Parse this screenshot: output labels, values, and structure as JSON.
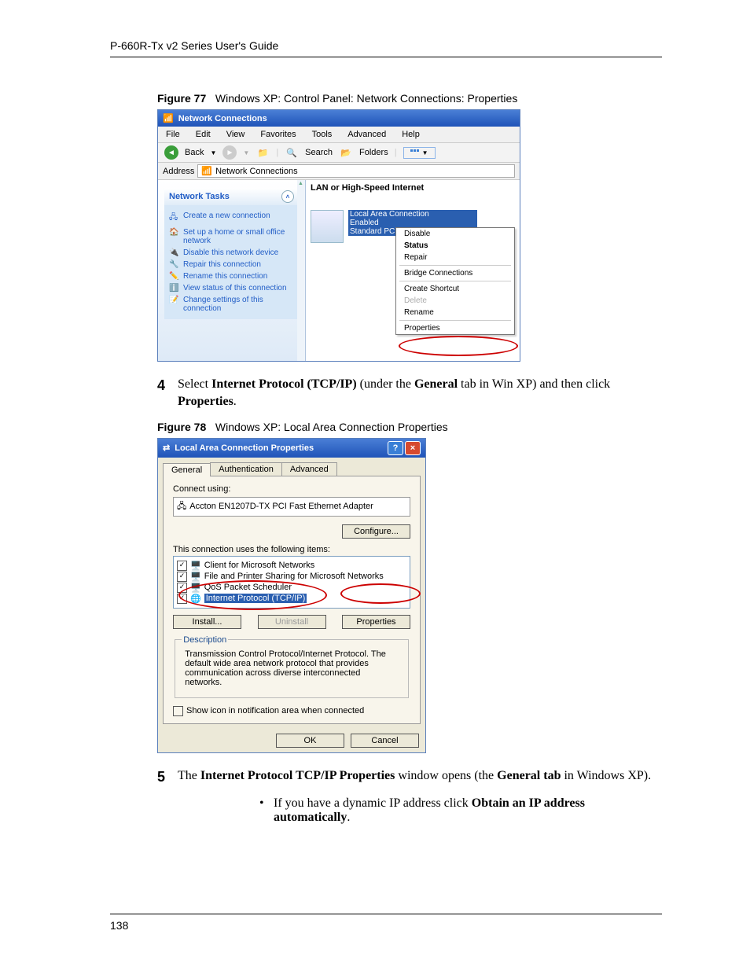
{
  "header_title": "P-660R-Tx v2 Series User's Guide",
  "page_number": "138",
  "figure77": {
    "label": "Figure 77",
    "title": "Windows XP: Control Panel: Network Connections: Properties"
  },
  "figure78": {
    "label": "Figure 78",
    "title": "Windows XP: Local Area Connection Properties"
  },
  "step4": {
    "num": "4",
    "text_before": "Select ",
    "b1": "Internet Protocol (TCP/IP)",
    "text_mid": " (under the ",
    "b2": "General",
    "text_mid2": " tab in Win XP) and then click ",
    "b3": "Properties",
    "text_after": "."
  },
  "step5": {
    "num": "5",
    "t1": "The ",
    "b1": "Internet Protocol TCP/IP Properties",
    "t2": " window opens (the ",
    "b2": "General tab",
    "t3": " in Windows XP)."
  },
  "bullet1": {
    "t1": "If you have a dynamic IP address click ",
    "b1": "Obtain an IP address automatically",
    "t2": "."
  },
  "win1": {
    "title": "Network Connections",
    "menu": {
      "file": "File",
      "edit": "Edit",
      "view": "View",
      "favorites": "Favorites",
      "tools": "Tools",
      "advanced": "Advanced",
      "help": "Help"
    },
    "toolbar": {
      "back": "Back",
      "search": "Search",
      "folders": "Folders"
    },
    "address_label": "Address",
    "address_value": "Network Connections",
    "tasks_header": "Network Tasks",
    "tasks": [
      "Create a new connection",
      "Set up a home or small office network",
      "Disable this network device",
      "Repair this connection",
      "Rename this connection",
      "View status of this connection",
      "Change settings of this connection"
    ],
    "section_head": "LAN or High-Speed Internet",
    "conn": {
      "name": "Local Area Connection",
      "status": "Enabled",
      "adapter": "Standard PCI Fast Ethernet Adapter"
    },
    "ctx": {
      "disable": "Disable",
      "status": "Status",
      "repair": "Repair",
      "bridge": "Bridge Connections",
      "shortcut": "Create Shortcut",
      "delete": "Delete",
      "rename": "Rename",
      "properties": "Properties"
    }
  },
  "win2": {
    "title": "Local Area Connection Properties",
    "tabs": {
      "general": "General",
      "auth": "Authentication",
      "advanced": "Advanced"
    },
    "connect_using": "Connect using:",
    "adapter": "Accton EN1207D-TX PCI Fast Ethernet Adapter",
    "configure": "Configure...",
    "uses_label": "This connection uses the following items:",
    "items": [
      "Client for Microsoft Networks",
      "File and Printer Sharing for Microsoft Networks",
      "QoS Packet Scheduler",
      "Internet Protocol (TCP/IP)"
    ],
    "install": "Install...",
    "uninstall": "Uninstall",
    "properties": "Properties",
    "desc_label": "Description",
    "desc_text": "Transmission Control Protocol/Internet Protocol. The default wide area network protocol that provides communication across diverse interconnected networks.",
    "show_icon": "Show icon in notification area when connected",
    "ok": "OK",
    "cancel": "Cancel"
  }
}
